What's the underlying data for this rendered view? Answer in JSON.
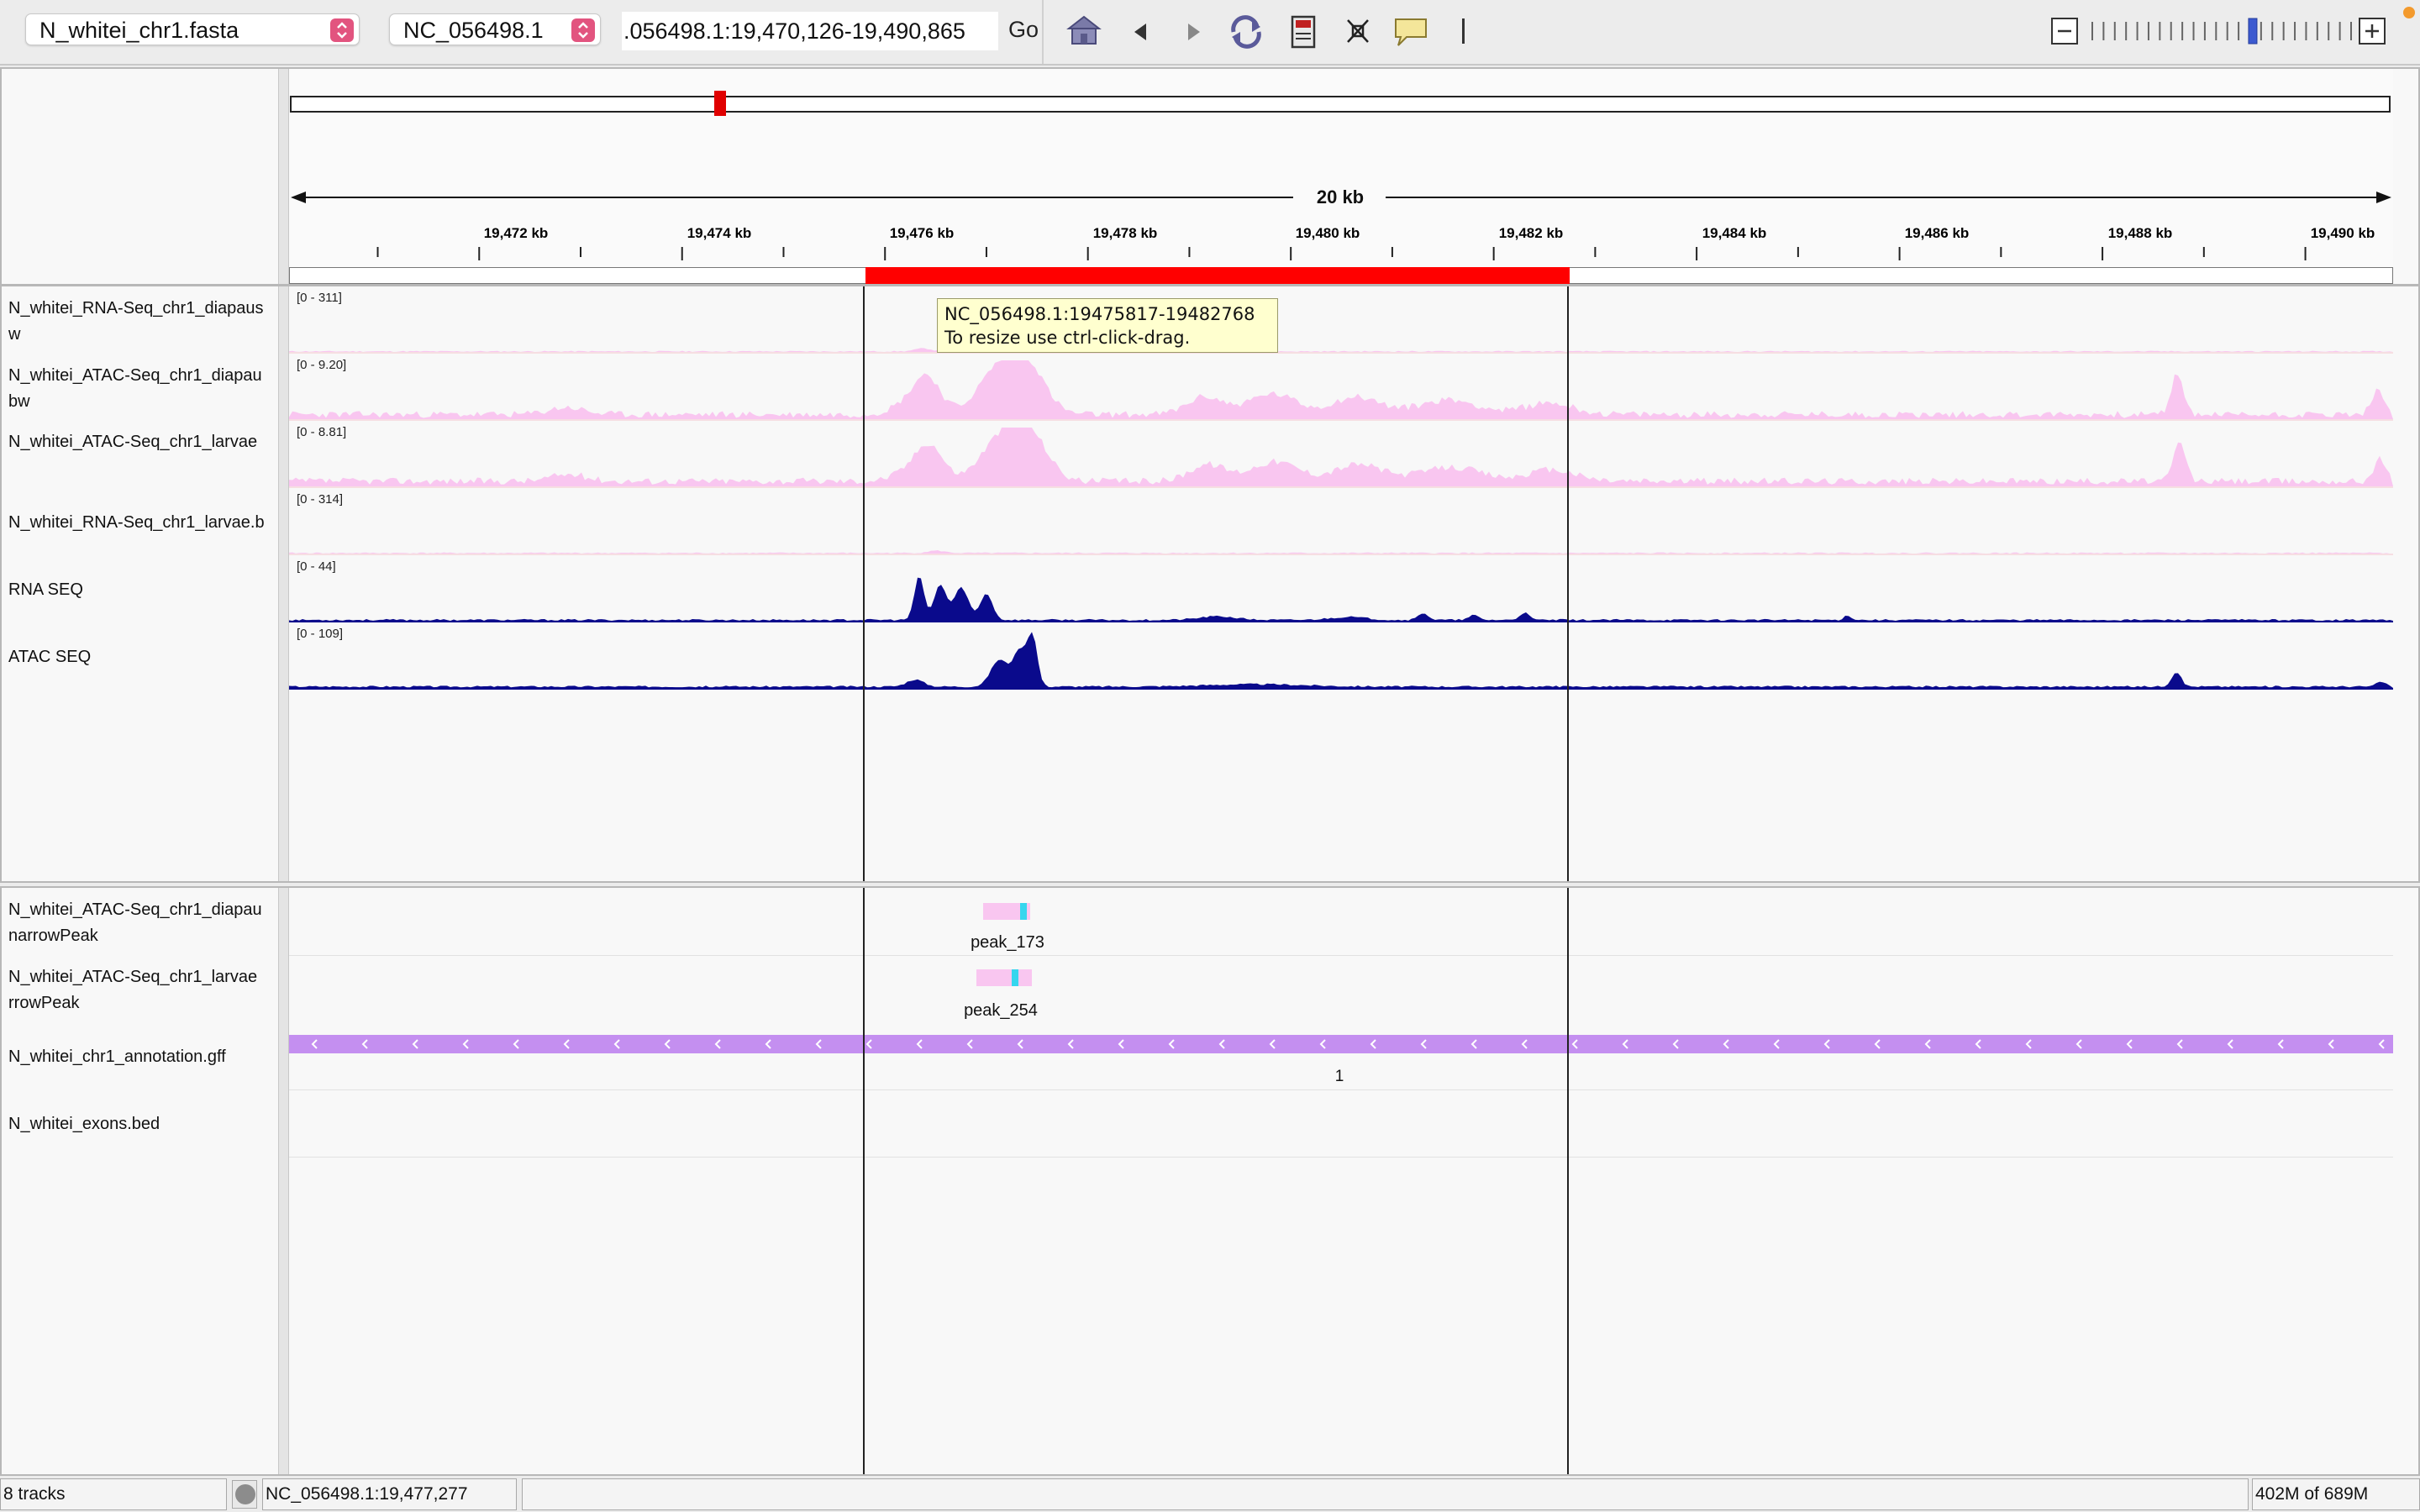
{
  "toolbar": {
    "genome": "N_whitei_chr1.fasta",
    "chromosome": "NC_056498.1",
    "locus": ".056498.1:19,470,126-19,490,865",
    "go_label": "Go",
    "icons": [
      "home-icon",
      "back-icon",
      "forward-icon",
      "refresh-icon",
      "region-icon",
      "fit-icon",
      "popup-icon"
    ],
    "zoom_level_fraction": 0.62
  },
  "ruler": {
    "scale_label": "20 kb",
    "ticks": [
      "19,472 kb",
      "19,474 kb",
      "19,476 kb",
      "19,478 kb",
      "19,480 kb",
      "19,482 kb",
      "19,484 kb",
      "19,486 kb",
      "19,488 kb",
      "19,490 kb"
    ]
  },
  "tracks": [
    {
      "label": "N_whitei_RNA-Seq_chr1_diapaus\nw",
      "range": "[0 - 311]"
    },
    {
      "label": "N_whitei_ATAC-Seq_chr1_diapau\nbw",
      "range": "[0 - 9.20]"
    },
    {
      "label": "N_whitei_ATAC-Seq_chr1_larvae",
      "range": "[0 - 8.81]"
    },
    {
      "label": "N_whitei_RNA-Seq_chr1_larvae.b",
      "range": "[0 - 314]"
    },
    {
      "label": "RNA SEQ",
      "range": "[0 - 44]"
    },
    {
      "label": "ATAC SEQ",
      "range": "[0 - 109]"
    }
  ],
  "feature_tracks": [
    {
      "label": "N_whitei_ATAC-Seq_chr1_diapau\nnarrowPeak",
      "feature": "peak_173"
    },
    {
      "label": "N_whitei_ATAC-Seq_chr1_larvae\nrrowPeak",
      "feature": "peak_254"
    },
    {
      "label": "N_whitei_chr1_annotation.gff",
      "feature": "1"
    },
    {
      "label": "N_whitei_exons.bed",
      "feature": ""
    }
  ],
  "tooltip": {
    "line1": "NC_056498.1:19475817-19482768",
    "line2": "To resize use ctrl-click-drag."
  },
  "status": {
    "tracks": "8 tracks",
    "position": "NC_056498.1:19,477,277",
    "memory": "402M of 689M"
  },
  "colors": {
    "roi": "#ff0000",
    "light_signal": "#f9c6f0",
    "dark_signal": "#0a0a8c",
    "peak_bar": "#f9c6f0",
    "peak_summit": "#36d6ee",
    "gene": "#c48ff0",
    "stepper": "#e2547f"
  }
}
